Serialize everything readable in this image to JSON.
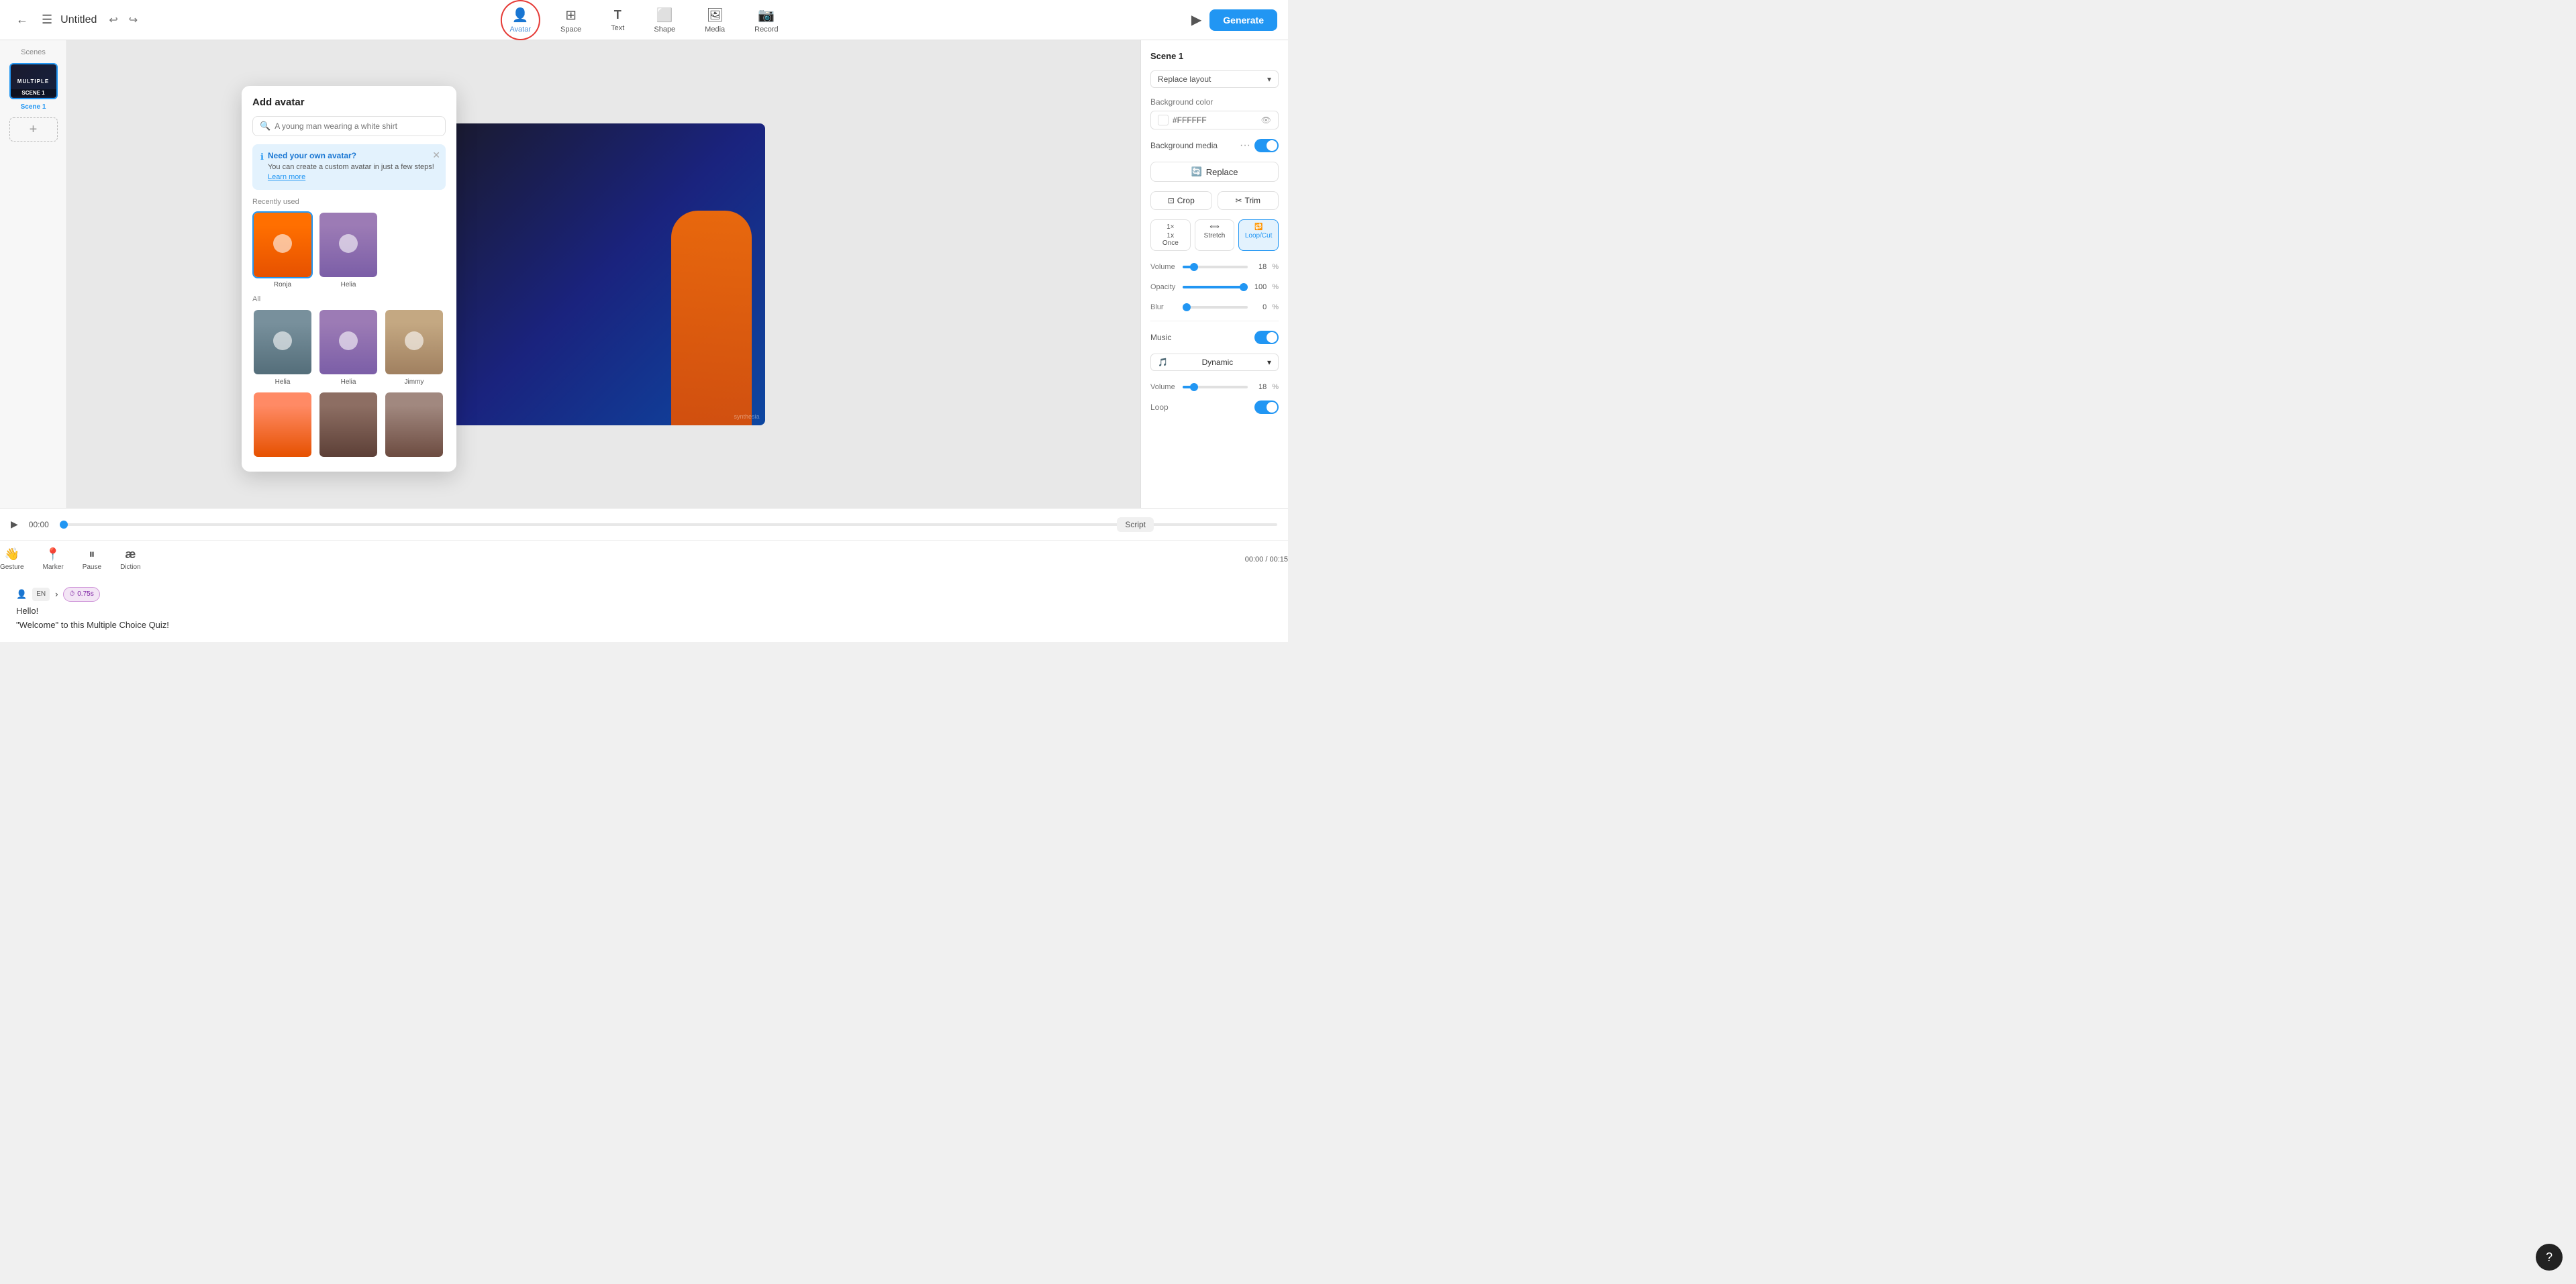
{
  "topbar": {
    "title": "Untitled",
    "back_label": "←",
    "menu_label": "☰",
    "undo_label": "↩",
    "redo_label": "↪",
    "tools": [
      {
        "id": "avatar",
        "label": "Avatar",
        "icon": "👤",
        "active": true
      },
      {
        "id": "space",
        "label": "Space",
        "icon": "⊞"
      },
      {
        "id": "text",
        "label": "Text",
        "icon": "T"
      },
      {
        "id": "shape",
        "label": "Shape",
        "icon": "⬜"
      },
      {
        "id": "media",
        "label": "Media",
        "icon": "🖼"
      },
      {
        "id": "record",
        "label": "Record",
        "icon": "📷"
      }
    ],
    "play_label": "▶",
    "generate_label": "Generate"
  },
  "scenes": {
    "label": "Scenes",
    "items": [
      {
        "id": "scene1",
        "label": "SCENE 1",
        "name": "Scene 1"
      }
    ],
    "add_label": "+"
  },
  "avatar_popup": {
    "title": "Add avatar",
    "search_placeholder": "A young man wearing a white shirt",
    "info_title": "Need your own avatar?",
    "info_text": "You can create a custom avatar in just a few steps!",
    "info_link": "Learn more",
    "recently_used_label": "Recently used",
    "all_label": "All",
    "avatars_recent": [
      {
        "name": "Ronja",
        "style": "ronja"
      },
      {
        "name": "Helia",
        "style": "helia1"
      }
    ],
    "avatars_all": [
      {
        "name": "Helia",
        "style": "helia2"
      },
      {
        "name": "Helia",
        "style": "helia3"
      },
      {
        "name": "Jimmy",
        "style": "jimmy"
      },
      {
        "name": "",
        "style": "small1"
      },
      {
        "name": "",
        "style": "small2"
      },
      {
        "name": "",
        "style": "small3"
      }
    ]
  },
  "right_panel": {
    "scene_label": "Scene 1",
    "replace_layout_label": "Replace layout",
    "bg_color_label": "Background color",
    "bg_color_value": "#FFFFFF",
    "bg_media_label": "Background media",
    "replace_label": "Replace",
    "crop_label": "Crop",
    "trim_label": "Trim",
    "playback_once": "1x\nOnce",
    "playback_stretch": "Stretch",
    "playback_loop": "Loop/Cut",
    "volume_label": "Volume",
    "volume_value": "18",
    "volume_unit": "%",
    "opacity_label": "Opacity",
    "opacity_value": "100",
    "opacity_unit": "%",
    "blur_label": "Blur",
    "blur_value": "0",
    "blur_unit": "%",
    "music_label": "Music",
    "music_option": "Dynamic",
    "music_volume_value": "18",
    "music_volume_unit": "%",
    "loop_label": "Loop"
  },
  "timeline": {
    "play_label": "▶",
    "time_label": "00:00",
    "script_label": "Script",
    "tools": [
      {
        "id": "gesture",
        "label": "Gesture",
        "icon": "👋"
      },
      {
        "id": "marker",
        "label": "Marker",
        "icon": "📍"
      },
      {
        "id": "pause",
        "label": "Pause",
        "icon": "⏸"
      },
      {
        "id": "diction",
        "label": "Diction",
        "icon": "æ"
      }
    ],
    "time_display": "00:00 / 00:15",
    "en_badge": "EN",
    "time_badge": "0.75s",
    "script_lines": [
      "Hello!",
      "\"Welcome\" to this Multiple Choice Quiz!"
    ]
  },
  "help": {
    "label": "?"
  }
}
